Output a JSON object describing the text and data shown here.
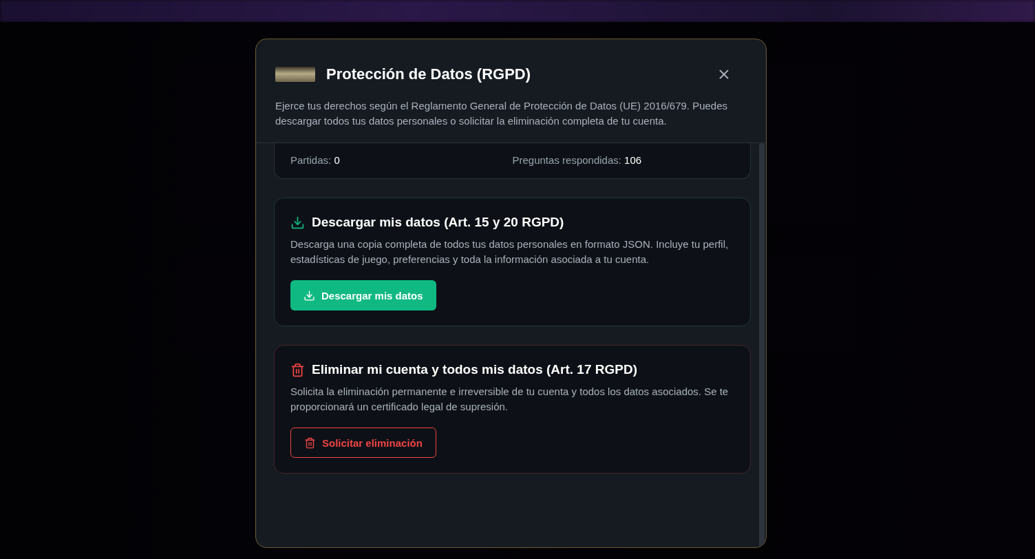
{
  "modal": {
    "title": "Protección de Datos (RGPD)",
    "description": "Ejerce tus derechos según el Reglamento General de Protección de Datos (UE) 2016/679. Puedes descargar todos tus datos personales o solicitar la eliminación completa de tu cuenta.",
    "stats": [
      {
        "label": "Partidas:",
        "value": "0"
      },
      {
        "label": "Preguntas respondidas:",
        "value": "106"
      }
    ],
    "sections": [
      {
        "kind": "download",
        "title": "Descargar mis datos (Art. 15 y 20 RGPD)",
        "text": "Descarga una copia completa de todos tus datos personales en formato JSON. Incluye tu perfil, estadísticas de juego, preferencias y toda la información asociada a tu cuenta.",
        "button": "Descargar mis datos"
      },
      {
        "kind": "delete",
        "title": "Eliminar mi cuenta y todos mis datos (Art. 17 RGPD)",
        "text": "Solicita la eliminación permanente e irreversible de tu cuenta y todos los datos asociados. Se te proporcionará un certificado legal de supresión.",
        "button": "Solicitar eliminación"
      }
    ]
  }
}
